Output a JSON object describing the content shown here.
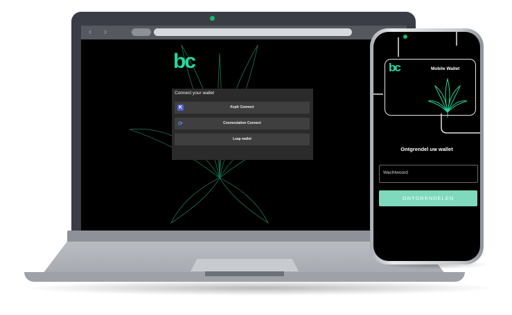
{
  "colors": {
    "accent": "#22d9a0",
    "button": "#7fd9bd",
    "background": "#000000"
  },
  "browser": {
    "back_icon": "chevron-left-icon",
    "forward_icon": "chevron-right-icon"
  },
  "laptop": {
    "logo": "bc",
    "modal": {
      "title": "Connect your wallet",
      "options": [
        {
          "label": "Keplr Connect",
          "icon": "keplr-icon"
        },
        {
          "label": "Cosmostation Connect",
          "icon": "cosmostation-icon"
        },
        {
          "label": "Leap wallet",
          "icon": ""
        }
      ]
    }
  },
  "phone": {
    "logo": "bc",
    "card_label": "Mobile Wallet",
    "unlock_title": "Ontgrendel uw wallet",
    "password_placeholder": "Wachtwoord",
    "unlock_button": "ONTGRENDELEN"
  }
}
